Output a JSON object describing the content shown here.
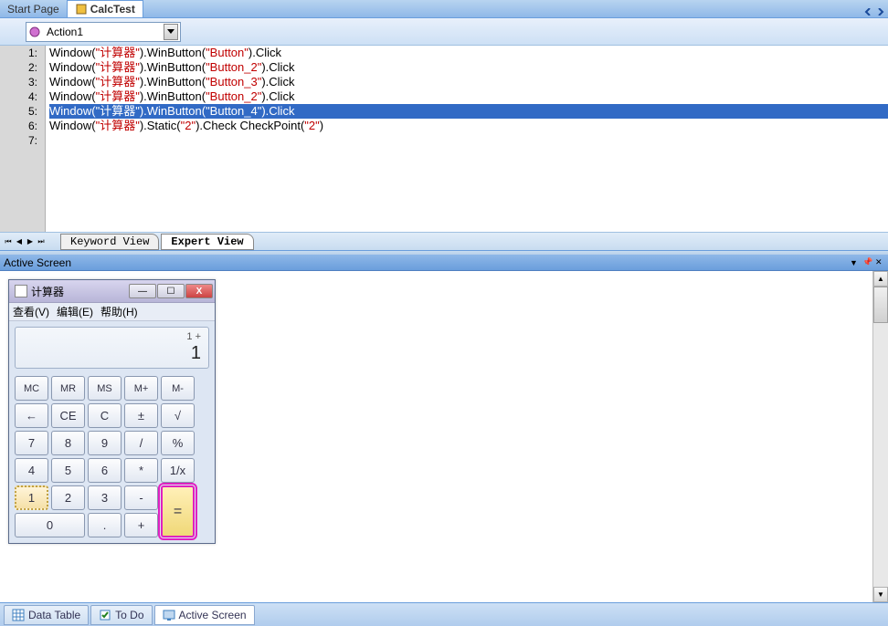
{
  "top_tabs": {
    "start_page": "Start Page",
    "calc_test": "CalcTest"
  },
  "action_dropdown": {
    "label": "Action1"
  },
  "code": {
    "lines": [
      {
        "num": "1:",
        "pre": "Window(",
        "s1": "\"计算器\"",
        "mid1": ").WinButton(",
        "s2": "\"Button\"",
        "post": ").Click"
      },
      {
        "num": "2:",
        "pre": "Window(",
        "s1": "\"计算器\"",
        "mid1": ").WinButton(",
        "s2": "\"Button_2\"",
        "post": ").Click"
      },
      {
        "num": "3:",
        "pre": "Window(",
        "s1": "\"计算器\"",
        "mid1": ").WinButton(",
        "s2": "\"Button_3\"",
        "post": ").Click"
      },
      {
        "num": "4:",
        "pre": "Window(",
        "s1": "\"计算器\"",
        "mid1": ").WinButton(",
        "s2": "\"Button_2\"",
        "post": ").Click"
      },
      {
        "num": "5:",
        "pre": "Window(",
        "s1": "\"计算器\"",
        "mid1": ").WinButton(",
        "s2": "\"Button_4\"",
        "post": ").Click",
        "selected": true
      },
      {
        "num": "6:",
        "pre": "Window(",
        "s1": "\"计算器\"",
        "mid1": ").Static(",
        "s2": "\"2\"",
        "mid2": ").Check CheckPoint(",
        "s3": "\"2\"",
        "post": ")"
      },
      {
        "num": "7:",
        "pre": "",
        "s1": "",
        "mid1": "",
        "s2": "",
        "post": ""
      }
    ]
  },
  "view_tabs": {
    "keyword": "Keyword View",
    "expert": "Expert View"
  },
  "active_screen": {
    "title": "Active Screen"
  },
  "calculator": {
    "title": "计算器",
    "menu": {
      "view": "查看(V)",
      "edit": "编辑(E)",
      "help": "帮助(H)"
    },
    "display_small": "1 +",
    "display_big": "1",
    "buttons": {
      "mc": "MC",
      "mr": "MR",
      "ms": "MS",
      "mplus": "M+",
      "mminus": "M-",
      "back": "←",
      "ce": "CE",
      "c": "C",
      "pm": "±",
      "sqrt": "√",
      "7": "7",
      "8": "8",
      "9": "9",
      "div": "/",
      "pct": "%",
      "4": "4",
      "5": "5",
      "6": "6",
      "mul": "*",
      "recip": "1/x",
      "1": "1",
      "2": "2",
      "3": "3",
      "minus": "-",
      "eq": "=",
      "0": "0",
      "dot": ".",
      "plus": "+"
    }
  },
  "bottom_tabs": {
    "data_table": "Data Table",
    "todo": "To Do",
    "active_screen": "Active Screen"
  }
}
